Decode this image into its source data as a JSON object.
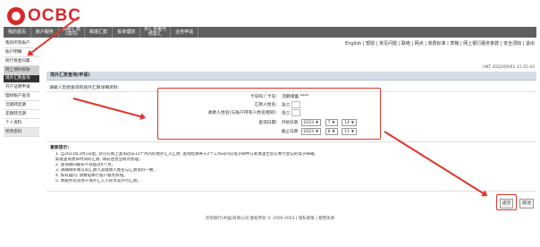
{
  "brand": {
    "logo_text": "OCBC"
  },
  "topnav": {
    "tabs": [
      {
        "label": "我的首页"
      },
      {
        "label": "账户服务"
      },
      {
        "label": "转账汇款",
        "label2": "(境内)"
      },
      {
        "label": "跨境汇款"
      },
      {
        "label": "投资理财"
      },
      {
        "label": "外汇买卖与",
        "label2": "结售汇"
      },
      {
        "label": "业务申请"
      }
    ]
  },
  "utility_links": "English  |  帮助  |  常见问题  |  联络  |  网点  |  收费标准  |  表格  |  网上银行服务条款  |  安全须知  |  退出",
  "sidebar": {
    "items": [
      {
        "label": "我的所有账户"
      },
      {
        "label": "账户明细"
      },
      {
        "label": "跨行资金归集"
      },
      {
        "label": "网上预约取款"
      },
      {
        "label": "境外汇款查询"
      },
      {
        "label": "开户证明申请"
      },
      {
        "label": "理财账户查询"
      },
      {
        "label": "活期转定期"
      },
      {
        "label": "定期转活期"
      },
      {
        "label": "个人资料"
      },
      {
        "label": "修改密码"
      }
    ]
  },
  "timestamp": "HKT 2022/09/01 11:25:43",
  "page_title": "境外汇款查询(申请)",
  "section_title": "请输入您想查询的境外汇款详细资料:",
  "form": {
    "account_label": "卡号码 / 卡号:",
    "account_value": "活期储蓄 ****",
    "remitter_label": "汇款人姓名:",
    "remitter_value": "张三",
    "beneficiary_label": "收款人姓名(与账户持有人姓名相同):",
    "beneficiary_value": "张三",
    "date_label": "查询日期:",
    "start_label": "开始日期",
    "end_label": "截止日期",
    "start_year": "2023",
    "start_month": "7",
    "start_day": "14",
    "end_year": "2023",
    "end_month": "8",
    "end_day": "11"
  },
  "notes": {
    "head": "重要提示:",
    "lines": [
      "1. 自2023年3月1日起, 您可在网上查询过去12个月内的境外汇入汇款, 查询结果将于2个工作日内以电子邮件方式发送至您在本行登记的电子邮箱。",
      "   如需查询更早时间的汇款, 请前往营业网点办理。",
      "2. 查询期间最长不得超过6个月。",
      "3. 请确保所填写的汇款人及收款人姓名与汇款资料一致。",
      "4. 如有疑问, 请致电本行客户服务热线。",
      "5. 本服务仅适用于境外汇入人民币及外币汇款。"
    ]
  },
  "buttons": {
    "submit": "递交",
    "cancel": "取消"
  },
  "footer": "华侨银行(中国)有限公司 版权所有 © 2009-2023 | 隐私政策 | 使用条款"
}
